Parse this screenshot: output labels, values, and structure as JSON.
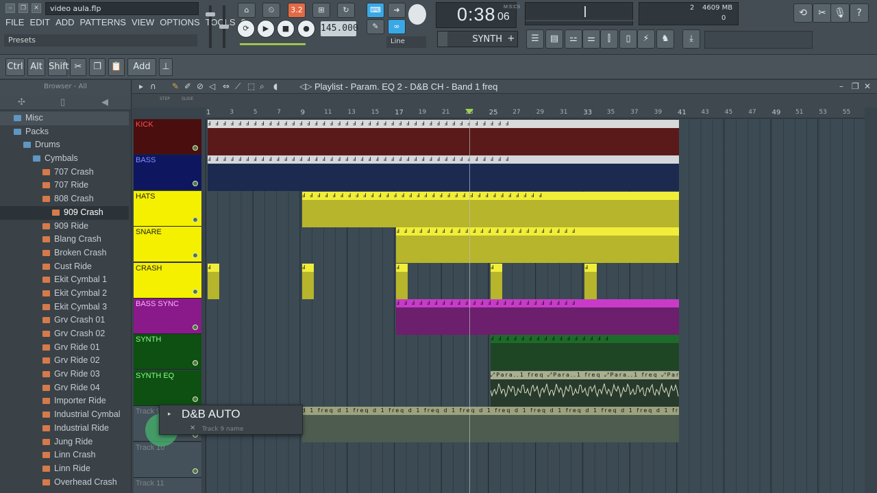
{
  "window": {
    "project_title": "video aula.flp"
  },
  "menu": [
    "FILE",
    "EDIT",
    "ADD",
    "PATTERNS",
    "VIEW",
    "OPTIONS",
    "TOOLS",
    "?"
  ],
  "presets_label": "Presets",
  "transport": {
    "pattern_song_label": "3.2",
    "tempo": "145.000",
    "snap": "Line"
  },
  "time": {
    "main": "0:38",
    "ms": "06",
    "unit": "M:S:CS"
  },
  "cpu": {
    "voices": "2",
    "memory": "4609 MB",
    "cpu": "0"
  },
  "pattern_name": "SYNTH",
  "shortcut_keys": [
    "Ctrl",
    "Alt",
    "Shift",
    "Add"
  ],
  "browser": {
    "title": "Browser - All",
    "items": [
      {
        "label": "Misc",
        "type": "folder",
        "indent": 0
      },
      {
        "label": "Packs",
        "type": "folder",
        "indent": 0
      },
      {
        "label": "Drums",
        "type": "folder",
        "indent": 1
      },
      {
        "label": "Cymbals",
        "type": "folder",
        "indent": 2
      },
      {
        "label": "707 Crash",
        "type": "file",
        "indent": 3
      },
      {
        "label": "707 Ride",
        "type": "file",
        "indent": 3
      },
      {
        "label": "808 Crash",
        "type": "file",
        "indent": 3
      },
      {
        "label": "909 Crash",
        "type": "file",
        "indent": 4
      },
      {
        "label": "909 Ride",
        "type": "file",
        "indent": 3
      },
      {
        "label": "Blang Crash",
        "type": "file",
        "indent": 3
      },
      {
        "label": "Broken Crash",
        "type": "file",
        "indent": 3
      },
      {
        "label": "Cust Ride",
        "type": "file",
        "indent": 3
      },
      {
        "label": "Ekit Cymbal 1",
        "type": "file",
        "indent": 3
      },
      {
        "label": "Ekit Cymbal 2",
        "type": "file",
        "indent": 3
      },
      {
        "label": "Ekit Cymbal 3",
        "type": "file",
        "indent": 3
      },
      {
        "label": "Grv Crash 01",
        "type": "file",
        "indent": 3
      },
      {
        "label": "Grv Crash 02",
        "type": "file",
        "indent": 3
      },
      {
        "label": "Grv Ride 01",
        "type": "file",
        "indent": 3
      },
      {
        "label": "Grv Ride 02",
        "type": "file",
        "indent": 3
      },
      {
        "label": "Grv Ride 03",
        "type": "file",
        "indent": 3
      },
      {
        "label": "Grv Ride 04",
        "type": "file",
        "indent": 3
      },
      {
        "label": "Importer Ride",
        "type": "file",
        "indent": 3
      },
      {
        "label": "Industrial Cymbal",
        "type": "file",
        "indent": 3
      },
      {
        "label": "Industrial Ride",
        "type": "file",
        "indent": 3
      },
      {
        "label": "Jung Ride",
        "type": "file",
        "indent": 3
      },
      {
        "label": "Linn Crash",
        "type": "file",
        "indent": 3
      },
      {
        "label": "Linn Ride",
        "type": "file",
        "indent": 3
      },
      {
        "label": "Overhead Crash",
        "type": "file",
        "indent": 3
      }
    ]
  },
  "playlist": {
    "title": "Playlist - Param. EQ 2 - D&B CH - Band 1 freq",
    "step_label": "STEP",
    "slide_label": "SLIDE",
    "ruler_ticks": [
      1,
      3,
      5,
      7,
      9,
      11,
      13,
      15,
      17,
      19,
      21,
      23,
      25,
      27,
      29,
      31,
      33,
      35,
      37,
      39,
      41,
      43,
      45,
      47,
      49,
      51,
      53,
      55
    ],
    "playhead_bar": 23.2,
    "tracks": [
      {
        "name": "KICK",
        "head_color": "#4a0e0e",
        "text_color": "#ff5050",
        "clips": [
          {
            "start": 1,
            "end": 41,
            "color": "#5a1a1a",
            "strip": "#d9d9d9",
            "pattern": "Ⅎ"
          }
        ]
      },
      {
        "name": "BASS",
        "head_color": "#0f1660",
        "text_color": "#7f90ff",
        "clips": [
          {
            "start": 1,
            "end": 41,
            "color": "#1c2a50",
            "strip": "#d4d8dc",
            "pattern": "Ⅎ"
          }
        ]
      },
      {
        "name": "HATS",
        "head_color": "#f4f000",
        "text_color": "#222222",
        "clips": [
          {
            "start": 9,
            "end": 41,
            "color": "#b7b52b",
            "strip": "#f0ee3a",
            "pattern": "Ⅎ"
          }
        ]
      },
      {
        "name": "SNARE",
        "head_color": "#f4f000",
        "text_color": "#222222",
        "clips": [
          {
            "start": 17,
            "end": 41,
            "color": "#b7b52b",
            "strip": "#f0ee3a",
            "pattern": "Ⅎ"
          }
        ]
      },
      {
        "name": "CRASH",
        "head_color": "#f4f000",
        "text_color": "#222222",
        "clips": [
          {
            "start": 1,
            "end": 2,
            "color": "#b7b52b",
            "strip": "#f0ee3a",
            "pattern": "Ⅎ"
          },
          {
            "start": 9,
            "end": 10,
            "color": "#b7b52b",
            "strip": "#f0ee3a",
            "pattern": "Ⅎ"
          },
          {
            "start": 17,
            "end": 18,
            "color": "#b7b52b",
            "strip": "#f0ee3a",
            "pattern": "Ⅎ"
          },
          {
            "start": 25,
            "end": 26,
            "color": "#b7b52b",
            "strip": "#f0ee3a",
            "pattern": "Ⅎ"
          },
          {
            "start": 33,
            "end": 34,
            "color": "#b7b52b",
            "strip": "#f0ee3a",
            "pattern": "Ⅎ"
          }
        ]
      },
      {
        "name": "BASS SYNC",
        "head_color": "#8a1a8a",
        "text_color": "#ffb0ff",
        "clips": [
          {
            "start": 17,
            "end": 41,
            "color": "#6c1f6c",
            "strip": "#c83bc8",
            "pattern": "Ⅎ"
          }
        ]
      },
      {
        "name": "SYNTH",
        "head_color": "#0e4f12",
        "text_color": "#8dff8d",
        "clips": [
          {
            "start": 25,
            "end": 41,
            "color": "#1e4625",
            "strip": "#1d6b2a",
            "pattern": "Ⅎ"
          }
        ]
      },
      {
        "name": "SYNTH EQ",
        "head_color": "#0e4f12",
        "text_color": "#8dff8d",
        "clips": [
          {
            "start": 25,
            "end": 41,
            "color": "#273a2c",
            "strip": "#a8b08e",
            "pattern": "⤢Para..1 freq",
            "wave": true
          }
        ]
      },
      {
        "name": "Track 9",
        "head_color": "#44505a",
        "text_color": "#7d868b",
        "clips": [
          {
            "start": 9,
            "end": 41,
            "color": "#4e5c4f",
            "strip": "#9da27e",
            "pattern": "d 1 freq"
          }
        ]
      },
      {
        "name": "Track 10",
        "head_color": "#44505a",
        "text_color": "#7d868b",
        "clips": []
      },
      {
        "name": "Track 11",
        "head_color": "#44505a",
        "text_color": "#7d868b",
        "clips": []
      }
    ]
  },
  "rename_popup": {
    "value": "D&B AUTO",
    "hint": "Track 9 name"
  }
}
